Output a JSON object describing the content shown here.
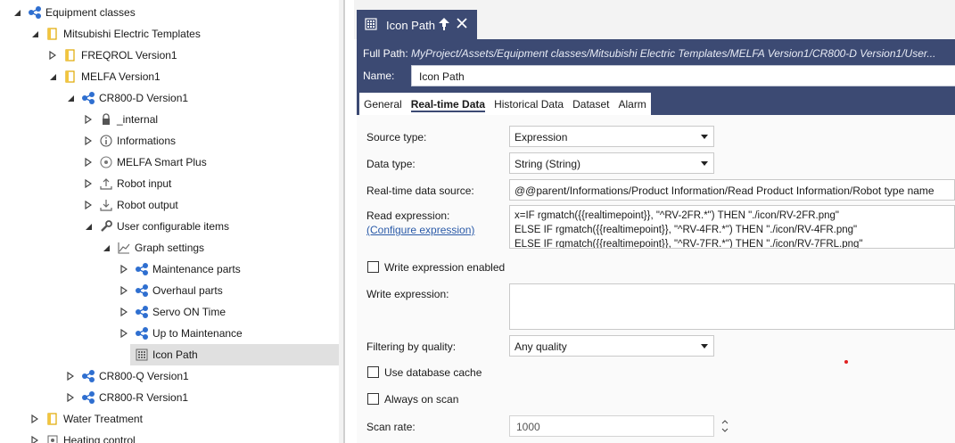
{
  "tree": {
    "nodes": [
      {
        "label": "Equipment classes",
        "state": "expanded",
        "icon": "class-group-icon"
      },
      {
        "label": "Mitsubishi Electric Templates",
        "state": "expanded",
        "icon": "folder-icon"
      },
      {
        "label": "FREQROL Version1",
        "state": "collapsed",
        "icon": "folder-icon"
      },
      {
        "label": "MELFA Version1",
        "state": "expanded",
        "icon": "folder-icon"
      },
      {
        "label": "CR800-D Version1",
        "state": "expanded",
        "icon": "class-group-icon"
      },
      {
        "label": "_internal",
        "state": "collapsed",
        "icon": "lock-icon"
      },
      {
        "label": "Informations",
        "state": "collapsed",
        "icon": "info-icon"
      },
      {
        "label": "MELFA Smart Plus",
        "state": "collapsed",
        "icon": "plus-circle-icon"
      },
      {
        "label": "Robot input",
        "state": "collapsed",
        "icon": "upload-icon"
      },
      {
        "label": "Robot output",
        "state": "collapsed",
        "icon": "download-icon"
      },
      {
        "label": "User configurable items",
        "state": "expanded",
        "icon": "wrench-icon"
      },
      {
        "label": "Graph settings",
        "state": "expanded",
        "icon": "line-chart-icon"
      },
      {
        "label": "Maintenance parts",
        "state": "collapsed",
        "icon": "class-group-icon"
      },
      {
        "label": "Overhaul parts",
        "state": "collapsed",
        "icon": "class-group-icon"
      },
      {
        "label": "Servo ON Time",
        "state": "collapsed",
        "icon": "class-group-icon"
      },
      {
        "label": "Up to Maintenance",
        "state": "collapsed",
        "icon": "class-group-icon"
      },
      {
        "label": "Icon Path",
        "state": "leaf",
        "icon": "tag-icon",
        "selected": true
      },
      {
        "label": "CR800-Q Version1",
        "state": "collapsed",
        "icon": "class-group-icon"
      },
      {
        "label": "CR800-R Version1",
        "state": "collapsed",
        "icon": "class-group-icon"
      },
      {
        "label": "Water Treatment",
        "state": "collapsed",
        "icon": "folder-icon"
      },
      {
        "label": "Heating control",
        "state": "collapsed",
        "icon": "gear-icon"
      }
    ]
  },
  "doc_tab": {
    "title": "Icon Path",
    "icon": "tag-icon"
  },
  "header": {
    "full_path_label": "Full Path:",
    "full_path_value": "MyProject/Assets/Equipment classes/Mitsubishi Electric Templates/MELFA Version1/CR800-D Version1/User...",
    "name_label": "Name:",
    "name_value": "Icon Path"
  },
  "subtabs": [
    "General",
    "Real-time Data",
    "Historical Data",
    "Dataset",
    "Alarm"
  ],
  "form": {
    "source_type_label": "Source type:",
    "source_type_value": "Expression",
    "data_type_label": "Data type:",
    "data_type_value": "String (String)",
    "rt_source_label": "Real-time data source:",
    "rt_source_value": "@@parent/Informations/Product Information/Read Product Information/Robot type name",
    "read_expr_label": "Read expression:",
    "configure_link": "(Configure expression)",
    "read_expr_lines": [
      "x=IF rgmatch({{realtimepoint}}, \"^RV-2FR.*\") THEN \"./icon/RV-2FR.png\"",
      "ELSE IF rgmatch({{realtimepoint}}, \"^RV-4FR.*\") THEN \"./icon/RV-4FR.png\"",
      "ELSE IF rgmatch({{realtimepoint}}, \"^RV-7FR.*\") THEN \"./icon/RV-7FRL.png\""
    ],
    "write_enabled_label": "Write expression enabled",
    "write_expr_label": "Write expression:",
    "filter_label": "Filtering by quality:",
    "filter_value": "Any quality",
    "db_cache_label": "Use database cache",
    "always_scan_label": "Always on scan",
    "scan_rate_label": "Scan rate:",
    "scan_rate_value": "1000"
  },
  "colors": {
    "header_bg": "#3c4a73",
    "accent_blue": "#2f6fd0",
    "folder_yellow": "#f2c53d"
  }
}
